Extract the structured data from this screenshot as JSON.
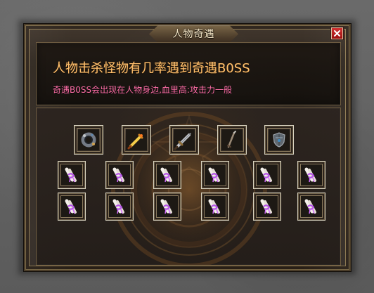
{
  "window": {
    "title": "人物奇遇"
  },
  "header": {
    "headline": "人物击杀怪物有几率遇到奇遇B0SS",
    "subline": "奇遇B0SS会出现在人物身边,血里高:攻击力一般"
  },
  "colors": {
    "headline": "#ffbf6d",
    "subline": "#ff6fa8",
    "close_button": "#c81f1f",
    "frame_gold": "#8f7a51"
  },
  "rewards": {
    "top_row": [
      {
        "icon": "bracelet-icon",
        "name": "top-reward-1"
      },
      {
        "icon": "golden-sword-icon",
        "name": "top-reward-2"
      },
      {
        "icon": "broadsword-icon",
        "name": "top-reward-3"
      },
      {
        "icon": "staff-icon",
        "name": "top-reward-4"
      },
      {
        "icon": "shield-helm-icon",
        "name": "top-reward-5"
      }
    ],
    "scroll_rows": [
      [
        {
          "icon": "scroll-icon",
          "name": "scroll-reward-1"
        },
        {
          "icon": "scroll-icon",
          "name": "scroll-reward-2"
        },
        {
          "icon": "scroll-icon",
          "name": "scroll-reward-3"
        },
        {
          "icon": "scroll-icon",
          "name": "scroll-reward-4"
        },
        {
          "icon": "scroll-icon",
          "name": "scroll-reward-5"
        },
        {
          "icon": "scroll-icon",
          "name": "scroll-reward-6"
        }
      ],
      [
        {
          "icon": "scroll-icon",
          "name": "scroll-reward-7"
        },
        {
          "icon": "scroll-icon",
          "name": "scroll-reward-8"
        },
        {
          "icon": "scroll-icon",
          "name": "scroll-reward-9"
        },
        {
          "icon": "scroll-icon",
          "name": "scroll-reward-10"
        },
        {
          "icon": "scroll-icon",
          "name": "scroll-reward-11"
        },
        {
          "icon": "scroll-icon",
          "name": "scroll-reward-12"
        }
      ]
    ]
  }
}
